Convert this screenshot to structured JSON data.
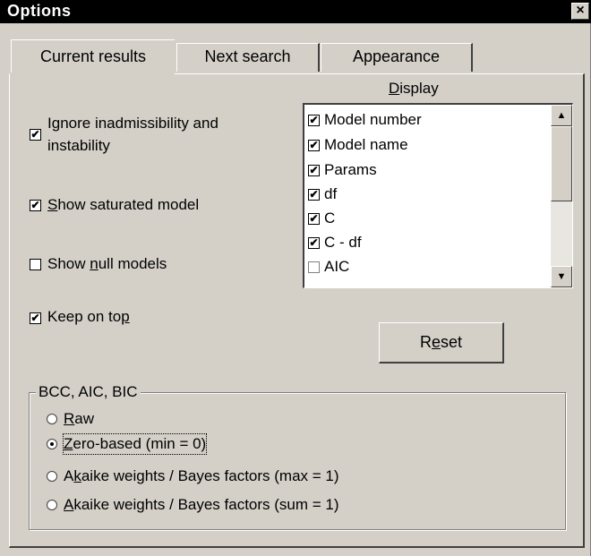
{
  "window": {
    "title": "Options",
    "close_glyph": "×"
  },
  "tabs": [
    {
      "label": "Current results",
      "active": true
    },
    {
      "label": "Next search",
      "active": false
    },
    {
      "label": "Appearance",
      "active": false
    }
  ],
  "options": {
    "ignore_inadmissibility": {
      "line1_pre": "I",
      "line1_u": "g",
      "line1_post": "nore inadmissibility and",
      "line2": "instability",
      "checked": true
    },
    "show_saturated": {
      "u": "S",
      "post": "how saturated model",
      "checked": true
    },
    "show_null": {
      "pre": "Show ",
      "u": "n",
      "post": "ull models",
      "checked": false
    },
    "keep_on_top": {
      "pre": "Keep on to",
      "u": "p",
      "checked": true
    }
  },
  "display": {
    "heading_u": "D",
    "heading_post": "isplay",
    "items": [
      {
        "label": "Model number",
        "checked": true
      },
      {
        "label": "Model name",
        "checked": true
      },
      {
        "label": "Params",
        "checked": true
      },
      {
        "label": "df",
        "checked": true
      },
      {
        "label": "C",
        "checked": true
      },
      {
        "label": "C - df",
        "checked": true
      },
      {
        "label": "AIC",
        "checked": false
      }
    ],
    "check_glyph": "✔",
    "scroll_up_glyph": "▲",
    "scroll_down_glyph": "▼"
  },
  "reset": {
    "pre": "R",
    "u": "e",
    "post": "set"
  },
  "group": {
    "title": "BCC, AIC, BIC",
    "radios": [
      {
        "pre": "",
        "u": "R",
        "post": "aw",
        "selected": false
      },
      {
        "pre": "",
        "u": "Z",
        "post": "ero-based (min = 0)",
        "selected": true
      },
      {
        "pre": "A",
        "u": "k",
        "post": "aike weights / Bayes factors (max = 1)",
        "selected": false
      },
      {
        "pre": "",
        "u": "A",
        "post": "kaike weights / Bayes factors (sum = 1)",
        "selected": false
      }
    ]
  },
  "colors": {
    "face": "#d4d0c8",
    "titlebar": "#000000"
  }
}
